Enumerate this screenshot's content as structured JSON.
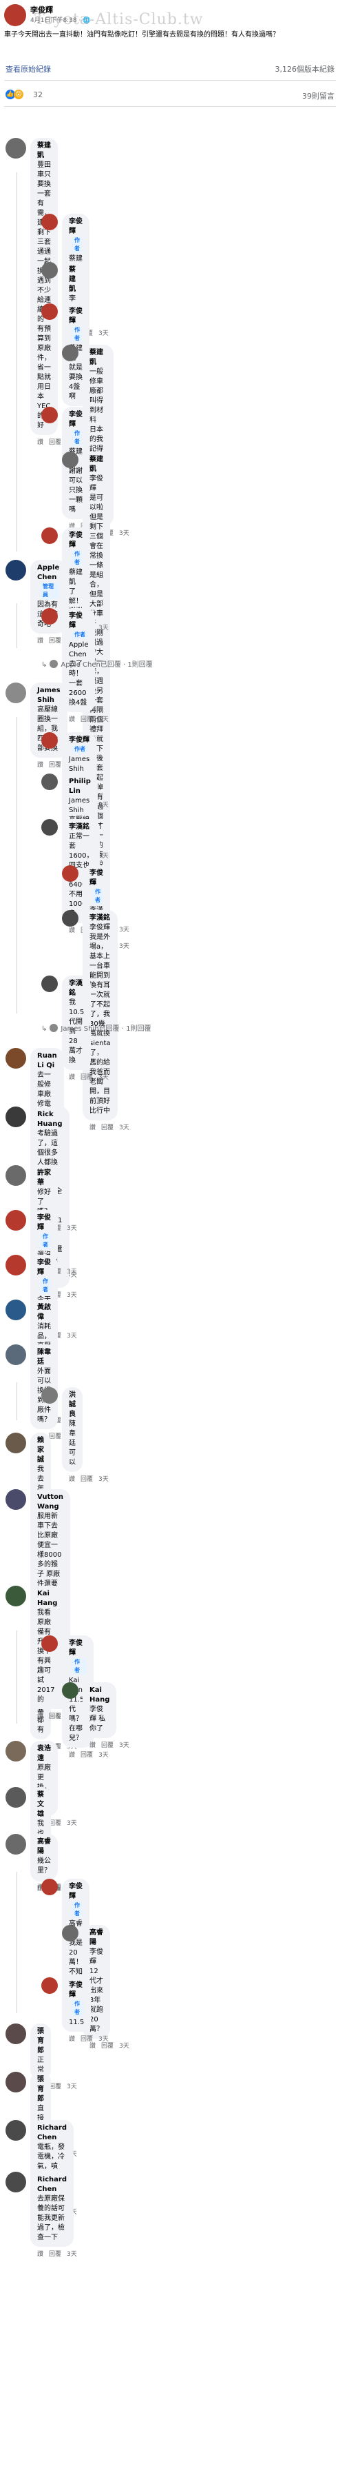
{
  "post": {
    "author": "李俊輝",
    "meta": "4月1日下午8:38 · 🌐",
    "watermark": "Toyota-Altis-Club.tw",
    "body": "車子今天開出去一直抖動！油門有點像吃釘！引擎還有去問是有換的問題！有人有換過嗎？",
    "see_original": "查看原始紀錄",
    "view_count": "3,126個版本紀錄",
    "reaction_count": "32",
    "share_count": "39則留言"
  },
  "colors": {
    "accent": "#1877f2",
    "link": "#385898",
    "muted": "#65676b",
    "bubble": "#f0f2f5"
  },
  "actions": {
    "like": "讚",
    "reply": "回覆"
  },
  "comments": [
    {
      "name": "蔡建凱",
      "tag": "",
      "text": "豐田車只要換一套有需，建議剩下三套通通一起換掉\n遇到不少給連續修的\n有預算到原廠件，省一點就用日本YEC的就好",
      "time": "3天",
      "av": "#6b6b6b"
    },
    {
      "name": "李俊輝",
      "tag": "作者",
      "text": "蔡建凱 請問去哪換有推薦嗎",
      "time": "3天",
      "av": "#b53a2d"
    },
    {
      "name": "蔡建凱",
      "tag": "",
      "text": "李俊輝 我也想問",
      "time": "3天",
      "av": "#6b6b6b"
    },
    {
      "name": "李俊輝",
      "tag": "作者",
      "text": "蔡建凱 就是要換4盤啊",
      "time": "3天",
      "av": "#b53a2d"
    },
    {
      "name": "蔡建凱",
      "tag": "",
      "text": "一般修車廠都叫得到材料\n日本的我記得我上次換好像一套大概1600吧！",
      "time": "3天",
      "av": "#6b6b6b"
    },
    {
      "name": "李俊輝",
      "tag": "作者",
      "text": "蔡建凱 謝謝可以只換一顆嗎",
      "time": "3天",
      "av": "#b53a2d"
    },
    {
      "name": "蔡建凱",
      "tag": "",
      "text": "李俊輝 是可以啦\n但是剩下三個會在常換一條是組合，但是大部分車子\n我剛遇過會大修一套，隔週後另一套\n再隔兩個禮拜後就剩下最後兩套一起換掉\n也有遇過一個月才換一套的\n這東西說不準什麼時候要換掉",
      "time": "3天",
      "av": "#6b6b6b"
    },
    {
      "name": "李俊輝",
      "tag": "作者",
      "text": "蔡建凱 了解！謝謝",
      "time": "3天",
      "av": "#b53a2d"
    },
    {
      "name": "Apple Chen",
      "tag": "管理員",
      "text": "因為有這種驚奇吧",
      "time": "3天",
      "av": "#1f3d6b"
    },
    {
      "name": "李俊輝",
      "tag": "作者",
      "text": "Apple Chen 去了時！一套2600換4盤",
      "time": "3天",
      "av": "#b53a2d"
    },
    {
      "name": "James Shih",
      "tag": "",
      "text": "高壓線圈換一組，我四組全部要換",
      "time": "3天",
      "av": "#8a8a8a"
    },
    {
      "name": "李俊輝",
      "tag": "作者",
      "text": "James Shih 要一套多少",
      "time": "3天",
      "av": "#b53a2d"
    },
    {
      "name": "Philip Lin",
      "tag": "",
      "text": "James Shih 高壓線圈 = 考驗？",
      "time": "3天",
      "av": "#5a5a5a"
    },
    {
      "name": "李漢銘",
      "tag": "",
      "text": "正常一套1600，四支也才6400，不用10000多",
      "time": "3天",
      "av": "#4a4a4a"
    },
    {
      "name": "李俊輝",
      "tag": "作者",
      "text": "李漢銘 感謝",
      "time": "3天",
      "av": "#b53a2d"
    },
    {
      "name": "李漢銘",
      "tag": "",
      "text": "李俊輝 我是外場a，基本上一台車能開到換有耳一次就了不起了，我30幾萬就換sienta了，\n舊的給我爸而老闆開，目前頂好比行中",
      "time": "3天",
      "av": "#4a4a4a"
    },
    {
      "name": "李漢銘",
      "tag": "",
      "text": "我10.5代開到28萬才換",
      "time": "3天",
      "av": "#4a4a4a"
    },
    {
      "name": "Ruan Li Qi",
      "tag": "",
      "text": "去一般修車廠修電路看有無結據法，唐晴，電瓶鎖寄都可也看正常，需要大換前要，",
      "time": "3天",
      "av": "#7a4a2a"
    },
    {
      "name": "Rick Huang",
      "tag": "",
      "text": "考驗過了，這個很多人都換過了，還是建議4支全換吧！\n常常遇到只換1支的，之後其餘3支還是陸續不定期的壞了",
      "time": "3天",
      "av": "#3a3a3a"
    },
    {
      "name": "許家華",
      "tag": "",
      "text": "修好了嗎？",
      "time": "3天",
      "av": "#6a6a6a"
    },
    {
      "name": "李俊輝",
      "tag": "作者",
      "text": "還沒",
      "time": "3天",
      "av": "#b53a2d"
    },
    {
      "name": "李俊輝",
      "tag": "作者",
      "text": "今天都沒開",
      "time": "3天",
      "av": "#b53a2d"
    },
    {
      "name": "黃啟偉",
      "tag": "",
      "text": "消耗品，高壓線圈一支壞建議四支全換新",
      "time": "3天",
      "av": "#2a5a8a"
    },
    {
      "name": "陳韋廷",
      "tag": "",
      "text": "外面可以換得到原廠件嗎？",
      "time": "3天",
      "av": "#5a6a7a"
    },
    {
      "name": "洪誠良",
      "tag": "",
      "text": "陳韋廷 可以",
      "time": "3天",
      "av": "#7a7a7a"
    },
    {
      "name": "賴家誠",
      "tag": "",
      "text": "我去年也是這樣開車一子抖動&油門踩不上去&最後火星塞都有",
      "time": "3天",
      "av": "#6a5a4a"
    },
    {
      "name": "Vutton Wang",
      "tag": "",
      "text": "服用新車下去\n比原廠便宜一樣8000多的猴子 原廠件還要等\n之前也是換一顆，原廠就要等三個月\n開車吧😅\n油門一踩又是一抖哦",
      "time": "3天",
      "av": "#4a4a6a"
    },
    {
      "name": "Kai Hang",
      "tag": "",
      "text": "我看原廠備有 升級換下 有興趣可試 2017的",
      "time": "3天",
      "av": "#3a5a3a"
    },
    {
      "name": "李俊輝",
      "tag": "作者",
      "text": "Kai Hang 11.5代嗎？在哪兒？",
      "time": "3天",
      "av": "#b53a2d"
    },
    {
      "name": "Kai Hang",
      "tag": "",
      "text": "李俊輝 私你了",
      "time": "3天",
      "av": "#3a5a3a"
    },
    {
      "name": "袁浩遠",
      "tag": "",
      "text": "原廠更換，有保固！",
      "time": "3天",
      "av": "#7a6a5a"
    },
    {
      "name": "蔡文雄",
      "tag": "",
      "text": "我也換原廠 的",
      "time": "3天",
      "av": "#5a5a5a"
    },
    {
      "name": "高睿陽",
      "tag": "",
      "text": "幾公里？",
      "time": "3天",
      "av": "#6a6a6a"
    },
    {
      "name": "李俊輝",
      "tag": "作者",
      "text": "高睿陽 我是20萬！不知道大家…",
      "time": "3天",
      "av": "#b53a2d"
    },
    {
      "name": "高睿陽",
      "tag": "",
      "text": "李俊輝12代才出來3年就跑20萬？",
      "time": "3天",
      "av": "#6a6a6a"
    },
    {
      "name": "李俊輝",
      "tag": "作者",
      "text": "11.5",
      "time": "3天",
      "av": "#b53a2d"
    },
    {
      "name": "張育郎",
      "tag": "",
      "text": "正常",
      "time": "3天",
      "av": "#5a4a4a"
    },
    {
      "name": "張育郎",
      "tag": "",
      "text": "直接全換",
      "time": "3天",
      "av": "#5a4a4a"
    },
    {
      "name": "Richard Chen",
      "tag": "",
      "text": "電瓶，發電機，冷氣，噴轉，可能是也，便宜！",
      "time": "3天",
      "av": "#4a4a4a"
    },
    {
      "name": "Richard Chen",
      "tag": "",
      "text": "去原廠保養的話可能我更新過了，檢查一下",
      "time": "3天",
      "av": "#4a4a4a"
    }
  ],
  "replies_links": [
    {
      "text": "Apple Chen已回覆 · 1則回覆"
    },
    {
      "text": "James Shih已回覆 · 1則回覆"
    }
  ]
}
